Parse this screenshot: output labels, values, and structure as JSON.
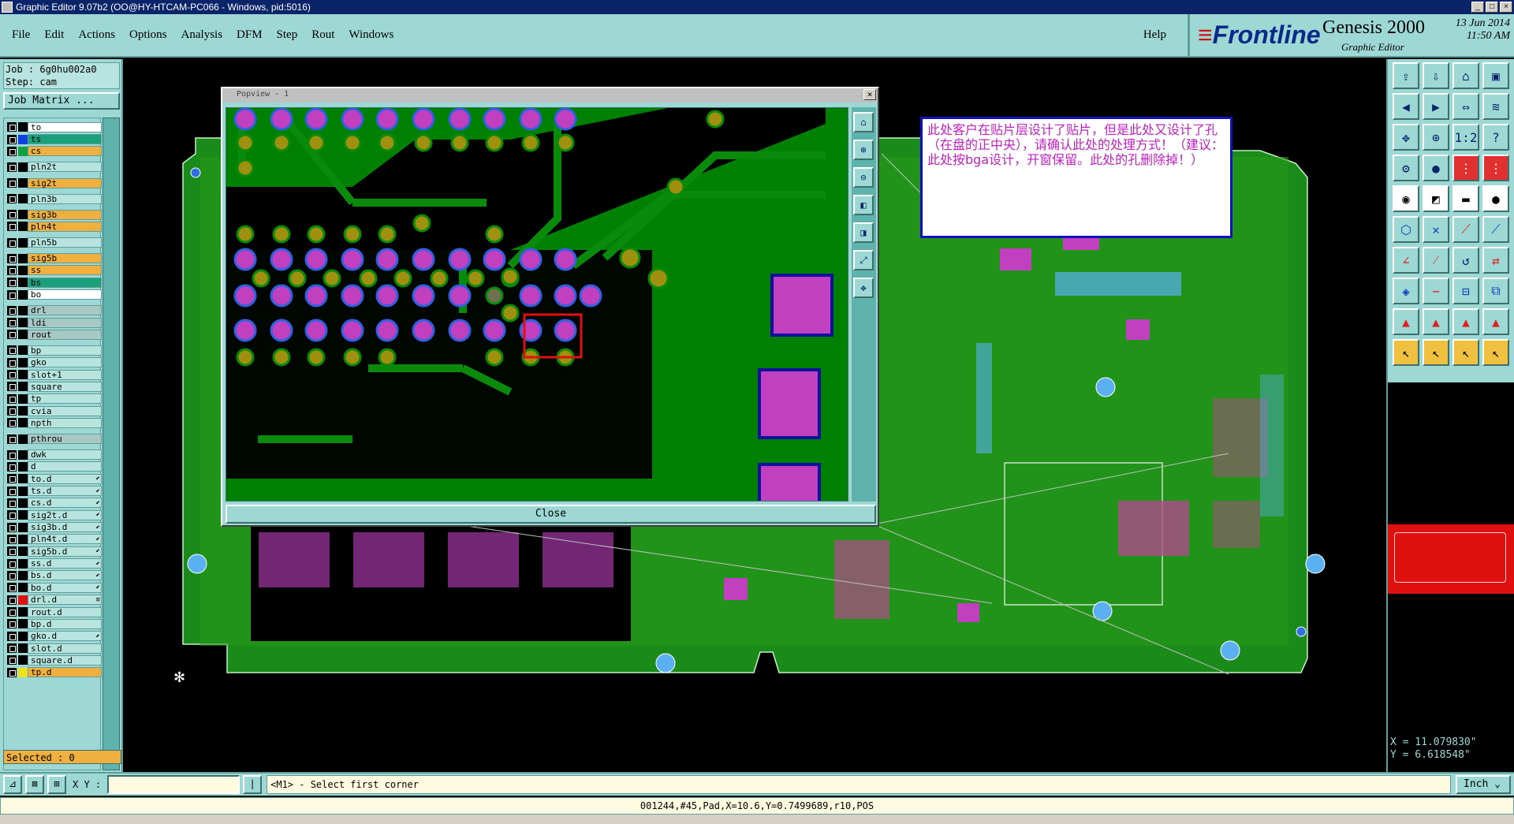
{
  "window": {
    "title": "Graphic Editor 9.07b2 (OO@HY-HTCAM-PC066 - Windows, pid:5016)",
    "buttons": [
      "_",
      "□",
      "×"
    ]
  },
  "menu": {
    "items": [
      "File",
      "Edit",
      "Actions",
      "Options",
      "Analysis",
      "DFM",
      "Step",
      "Rout",
      "Windows"
    ],
    "help": "Help"
  },
  "brand": {
    "logo": "Frontline",
    "product": "Genesis 2000",
    "subtitle": "Graphic Editor",
    "date": "13 Jun 2014",
    "time": "11:50 AM"
  },
  "job": {
    "job_line": "Job : 6g0hu002a0",
    "step_line": "Step: cam",
    "matrix_button": "Job Matrix ..."
  },
  "layers": [
    {
      "name": "to",
      "style": "white",
      "swatch": "#000000"
    },
    {
      "name": "ts",
      "style": "teal",
      "swatch": "#1040e0"
    },
    {
      "name": "cs",
      "style": "orange",
      "swatch": "#10a040"
    },
    {
      "name": "pln2t",
      "style": "hl",
      "swatch": "#000000"
    },
    {
      "name": "sig2t",
      "style": "orange",
      "swatch": "#000000"
    },
    {
      "name": "pln3b",
      "style": "hl",
      "swatch": "#000000"
    },
    {
      "name": "sig3b",
      "style": "orange",
      "swatch": "#000000"
    },
    {
      "name": "pln4t",
      "style": "orange",
      "swatch": "#000000"
    },
    {
      "name": "pln5b",
      "style": "hl",
      "swatch": "#000000"
    },
    {
      "name": "sig5b",
      "style": "orange",
      "swatch": "#000000"
    },
    {
      "name": "ss",
      "style": "orange",
      "swatch": "#000000"
    },
    {
      "name": "bs",
      "style": "teal",
      "swatch": "#000000"
    },
    {
      "name": "bo",
      "style": "white",
      "swatch": "#000000"
    },
    {
      "name": "drl",
      "style": "grey",
      "swatch": "#000000"
    },
    {
      "name": "ldi",
      "style": "grey",
      "swatch": "#000000"
    },
    {
      "name": "rout",
      "style": "grey",
      "swatch": "#000000"
    },
    {
      "name": "bp",
      "style": "hl",
      "swatch": "#000000"
    },
    {
      "name": "gko",
      "style": "hl",
      "swatch": "#000000"
    },
    {
      "name": "slot+1",
      "style": "hl",
      "swatch": "#000000"
    },
    {
      "name": "square",
      "style": "hl",
      "swatch": "#000000"
    },
    {
      "name": "tp",
      "style": "hl",
      "swatch": "#000000"
    },
    {
      "name": "cvia",
      "style": "hl",
      "swatch": "#000000"
    },
    {
      "name": "npth",
      "style": "hl",
      "swatch": "#000000"
    },
    {
      "name": "pthrou",
      "style": "grey",
      "swatch": "#000000"
    },
    {
      "name": "dwk",
      "style": "hl",
      "swatch": "#000000"
    },
    {
      "name": "d",
      "style": "hl",
      "swatch": "#000000"
    },
    {
      "name": "to.d",
      "style": "hl",
      "swatch": "#000000",
      "flag": "⬋"
    },
    {
      "name": "ts.d",
      "style": "hl",
      "swatch": "#000000",
      "flag": "⬋"
    },
    {
      "name": "cs.d",
      "style": "hl",
      "swatch": "#000000",
      "flag": "⬋"
    },
    {
      "name": "sig2t.d",
      "style": "hl",
      "swatch": "#000000",
      "flag": "⬋"
    },
    {
      "name": "sig3b.d",
      "style": "hl",
      "swatch": "#000000",
      "flag": "⬋"
    },
    {
      "name": "pln4t.d",
      "style": "hl",
      "swatch": "#000000",
      "flag": "⬋"
    },
    {
      "name": "sig5b.d",
      "style": "hl",
      "swatch": "#000000",
      "flag": "⬋"
    },
    {
      "name": "ss.d",
      "style": "hl",
      "swatch": "#000000",
      "flag": "⬋"
    },
    {
      "name": "bs.d",
      "style": "hl",
      "swatch": "#000000",
      "flag": "⬋"
    },
    {
      "name": "bo.d",
      "style": "hl",
      "swatch": "#000000",
      "flag": "⬋"
    },
    {
      "name": "drl.d",
      "style": "hl",
      "swatch": "#e01010",
      "flag": "≡"
    },
    {
      "name": "rout.d",
      "style": "hl",
      "swatch": "#000000"
    },
    {
      "name": "bp.d",
      "style": "hl",
      "swatch": "#000000"
    },
    {
      "name": "gko.d",
      "style": "hl",
      "swatch": "#000000",
      "flag": "⬋"
    },
    {
      "name": "slot.d",
      "style": "hl",
      "swatch": "#000000"
    },
    {
      "name": "square.d",
      "style": "hl",
      "swatch": "#000000"
    },
    {
      "name": "tp.d",
      "style": "orange",
      "swatch": "#f0e020"
    }
  ],
  "selected": "Selected : 0",
  "coords": {
    "x": "X = 11.079830\"",
    "y": "Y = 6.618548\""
  },
  "popview": {
    "title": "Popview - 1",
    "close_button": "Close"
  },
  "note": {
    "text": "此处客户在贴片层设计了贴片，但是此处又设计了孔（在盘的正中央），请确认此处的处理方式！（建议：此处按bga设计，开窗保留。此处的孔删除掉！）"
  },
  "command": {
    "xy_label": "X Y :",
    "xy_value": "",
    "prompt": "<M1> - Select first corner",
    "units": "Inch"
  },
  "status": {
    "feature_info": "001244,#45,Pad,X=10.6,Y=0.7499689,r10,POS"
  },
  "colors": {
    "panel": "#9dd8d4",
    "board_green": "#008000",
    "pad_magenta": "#c040c0",
    "highlight": "#f0b040"
  }
}
